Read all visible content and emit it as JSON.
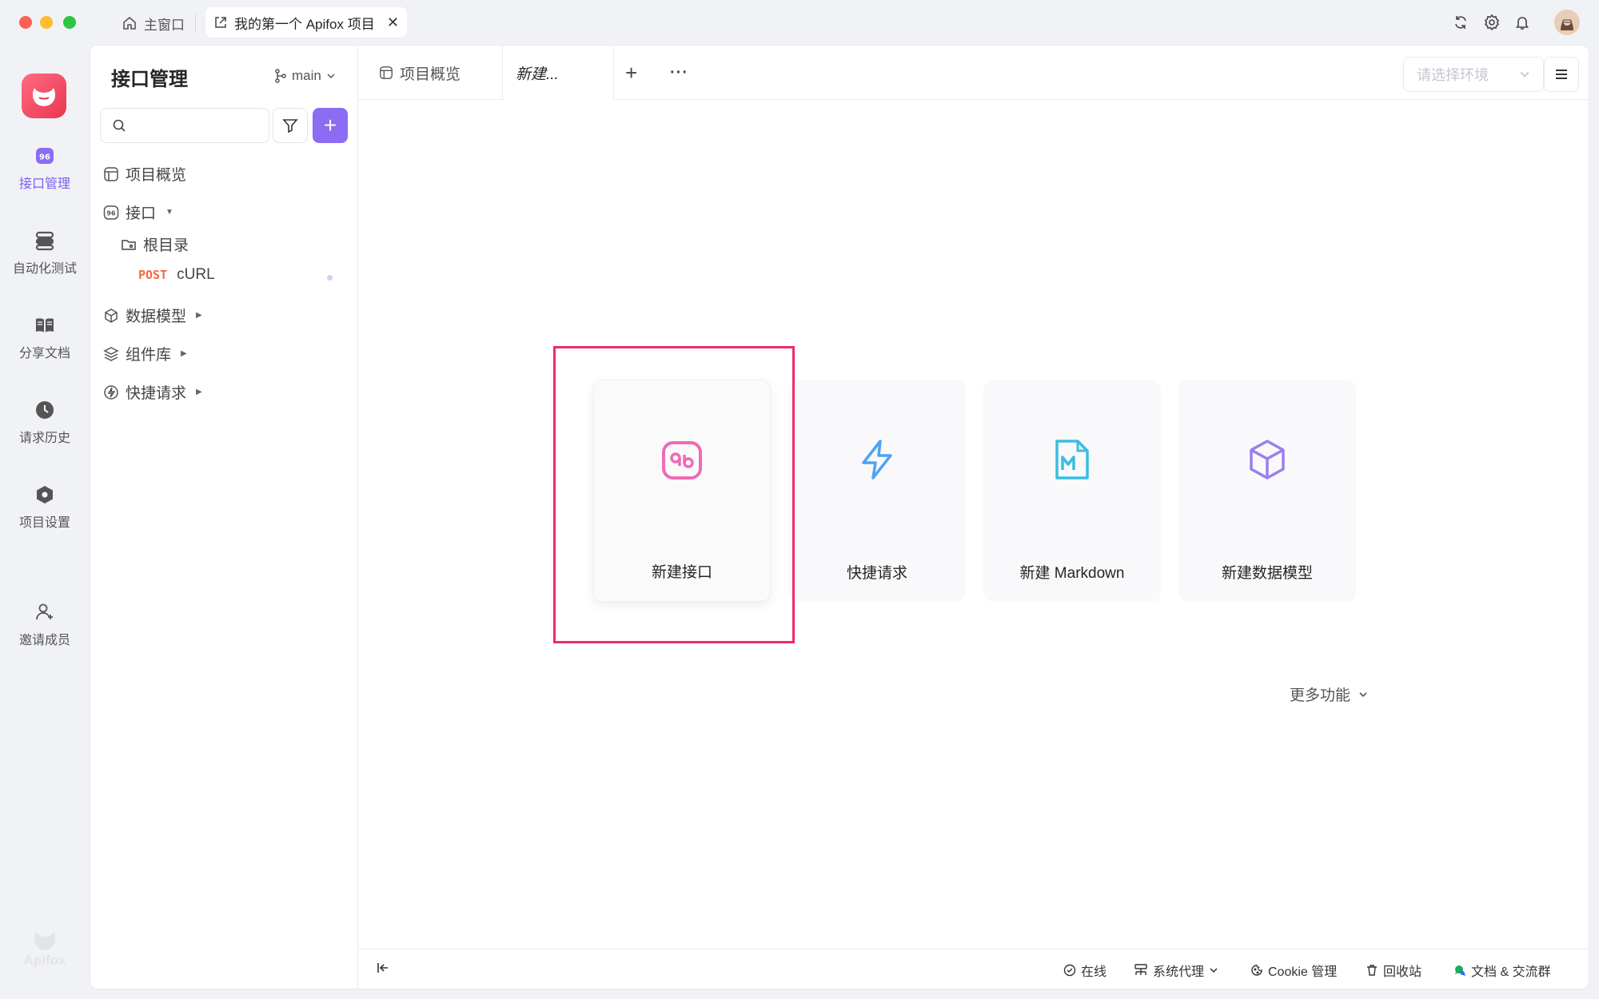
{
  "window": {
    "home_tab_label": "主窗口",
    "project_tab_label": "我的第一个 Apifox 项目",
    "close_glyph": "✕"
  },
  "leftnav": {
    "items": [
      {
        "label": "接口管理",
        "icon": "api-icon",
        "active": true
      },
      {
        "label": "自动化测试",
        "icon": "automation-icon",
        "active": false
      },
      {
        "label": "分享文档",
        "icon": "book-icon",
        "active": false
      },
      {
        "label": "请求历史",
        "icon": "clock-icon",
        "active": false
      },
      {
        "label": "项目设置",
        "icon": "hexagon-settings-icon",
        "active": false
      },
      {
        "label": "邀请成员",
        "icon": "add-user-icon",
        "active": false
      }
    ],
    "watermark": "Apifox"
  },
  "sidebar": {
    "title": "接口管理",
    "branch": "main",
    "add_glyph": "+",
    "tree": {
      "overview": "项目概览",
      "api": "接口",
      "root_dir": "根目录",
      "endpoint_method": "POST",
      "endpoint_name": "cURL",
      "data_model": "数据模型",
      "components": "组件库",
      "quick_request": "快捷请求"
    }
  },
  "tabs": {
    "overview": "项目概览",
    "new": "新建...",
    "add_glyph": "+",
    "more_glyph": "···"
  },
  "env": {
    "placeholder": "请选择环境"
  },
  "cards": [
    {
      "label": "新建接口",
      "icon": "api-icon",
      "color": "#f06ab6"
    },
    {
      "label": "快捷请求",
      "icon": "lightning-icon",
      "color": "#4da3f5"
    },
    {
      "label": "新建 Markdown",
      "icon": "markdown-icon",
      "color": "#3cbde0"
    },
    {
      "label": "新建数据模型",
      "icon": "cube-icon",
      "color": "#9a7ff0"
    }
  ],
  "more_features": "更多功能",
  "footer": {
    "online": "在线",
    "proxy": "系统代理",
    "cookie": "Cookie 管理",
    "recycle": "回收站",
    "docs": "文档 & 交流群"
  },
  "colors": {
    "accent": "#8b6cf2",
    "highlight": "#ee2b6b",
    "post": "#f56a3c"
  }
}
